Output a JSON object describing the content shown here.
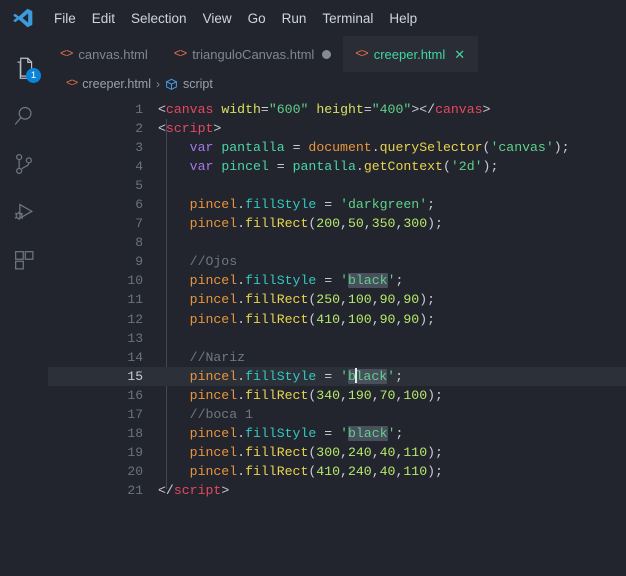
{
  "window": {
    "app_logo": "vscode-logo",
    "background": "#22252d"
  },
  "menubar": {
    "items": [
      {
        "label": "File"
      },
      {
        "label": "Edit"
      },
      {
        "label": "Selection"
      },
      {
        "label": "View"
      },
      {
        "label": "Go"
      },
      {
        "label": "Run"
      },
      {
        "label": "Terminal"
      },
      {
        "label": "Help"
      }
    ]
  },
  "activitybar": {
    "items": [
      {
        "name": "explorer",
        "icon": "files-icon",
        "active": true,
        "badge": "1"
      },
      {
        "name": "search",
        "icon": "search-icon",
        "active": false,
        "badge": ""
      },
      {
        "name": "source-control",
        "icon": "source-control-icon",
        "active": false,
        "badge": ""
      },
      {
        "name": "run-and-debug",
        "icon": "run-and-debug-icon",
        "active": false,
        "badge": ""
      },
      {
        "name": "extensions",
        "icon": "extensions-icon",
        "active": false,
        "badge": ""
      }
    ]
  },
  "tabs": [
    {
      "label": "canvas.html",
      "icon": "html-icon",
      "active": false,
      "dirty": false,
      "close": ""
    },
    {
      "label": "trianguloCanvas.html",
      "icon": "html-icon",
      "active": false,
      "dirty": true,
      "close": ""
    },
    {
      "label": "creeper.html",
      "icon": "html-icon",
      "active": true,
      "dirty": false,
      "close": "✕"
    }
  ],
  "breadcrumbs": {
    "file_icon": "html-icon",
    "file": "creeper.html",
    "separator": "›",
    "symbol_icon": "symbol-namespace-icon",
    "symbol": "script"
  },
  "editor": {
    "language": "html",
    "active_line": 15,
    "cursor": {
      "line": 15,
      "column": 26
    },
    "highlight_word": "black",
    "colors": {
      "background": "#22252d",
      "current_line": "#2c3039",
      "line_number": "#6b7280",
      "line_number_active": "#c8ccd4",
      "tag": "#e8475f",
      "attribute": "#d7e05f",
      "string": "#5fd18a",
      "keyword": "#a678e8",
      "variable": "#4ad6a8",
      "object": "#e8953d",
      "function": "#e8d44d",
      "property": "#35c8c0",
      "number": "#b6e86b",
      "comment": "#707782",
      "accent_green": "#3fd6a0",
      "badge_blue": "#0a84d8",
      "html_icon": "#e8714b"
    },
    "lines": [
      {
        "n": "1",
        "tokens": [
          {
            "t": "punc",
            "v": "<"
          },
          {
            "t": "tag",
            "v": "canvas"
          },
          {
            "t": "plain",
            "v": " "
          },
          {
            "t": "attr",
            "v": "width"
          },
          {
            "t": "punc",
            "v": "="
          },
          {
            "t": "str",
            "v": "\"600\""
          },
          {
            "t": "plain",
            "v": " "
          },
          {
            "t": "attr",
            "v": "height"
          },
          {
            "t": "punc",
            "v": "="
          },
          {
            "t": "str",
            "v": "\"400\""
          },
          {
            "t": "punc",
            "v": "></"
          },
          {
            "t": "tag",
            "v": "canvas"
          },
          {
            "t": "punc",
            "v": ">"
          }
        ]
      },
      {
        "n": "2",
        "tokens": [
          {
            "t": "punc",
            "v": "<"
          },
          {
            "t": "tag",
            "v": "script"
          },
          {
            "t": "punc",
            "v": ">"
          }
        ]
      },
      {
        "n": "3",
        "tokens": [
          {
            "t": "plain",
            "v": "    "
          },
          {
            "t": "kw",
            "v": "var"
          },
          {
            "t": "plain",
            "v": " "
          },
          {
            "t": "var",
            "v": "pantalla"
          },
          {
            "t": "plain",
            "v": " "
          },
          {
            "t": "op",
            "v": "="
          },
          {
            "t": "plain",
            "v": " "
          },
          {
            "t": "obj",
            "v": "document"
          },
          {
            "t": "punc",
            "v": "."
          },
          {
            "t": "fn",
            "v": "querySelector"
          },
          {
            "t": "punc",
            "v": "("
          },
          {
            "t": "str",
            "v": "'canvas'"
          },
          {
            "t": "punc",
            "v": ");"
          }
        ]
      },
      {
        "n": "4",
        "tokens": [
          {
            "t": "plain",
            "v": "    "
          },
          {
            "t": "kw",
            "v": "var"
          },
          {
            "t": "plain",
            "v": " "
          },
          {
            "t": "var",
            "v": "pincel"
          },
          {
            "t": "plain",
            "v": " "
          },
          {
            "t": "op",
            "v": "="
          },
          {
            "t": "plain",
            "v": " "
          },
          {
            "t": "var",
            "v": "pantalla"
          },
          {
            "t": "punc",
            "v": "."
          },
          {
            "t": "fn",
            "v": "getContext"
          },
          {
            "t": "punc",
            "v": "("
          },
          {
            "t": "str",
            "v": "'2d'"
          },
          {
            "t": "punc",
            "v": ");"
          }
        ]
      },
      {
        "n": "5",
        "tokens": []
      },
      {
        "n": "6",
        "tokens": [
          {
            "t": "plain",
            "v": "    "
          },
          {
            "t": "obj",
            "v": "pincel"
          },
          {
            "t": "punc",
            "v": "."
          },
          {
            "t": "prop",
            "v": "fillStyle"
          },
          {
            "t": "plain",
            "v": " "
          },
          {
            "t": "op",
            "v": "="
          },
          {
            "t": "plain",
            "v": " "
          },
          {
            "t": "str",
            "v": "'darkgreen'"
          },
          {
            "t": "punc",
            "v": ";"
          }
        ]
      },
      {
        "n": "7",
        "tokens": [
          {
            "t": "plain",
            "v": "    "
          },
          {
            "t": "obj",
            "v": "pincel"
          },
          {
            "t": "punc",
            "v": "."
          },
          {
            "t": "fn",
            "v": "fillRect"
          },
          {
            "t": "punc",
            "v": "("
          },
          {
            "t": "num",
            "v": "200"
          },
          {
            "t": "punc",
            "v": ","
          },
          {
            "t": "num",
            "v": "50"
          },
          {
            "t": "punc",
            "v": ","
          },
          {
            "t": "num",
            "v": "350"
          },
          {
            "t": "punc",
            "v": ","
          },
          {
            "t": "num",
            "v": "300"
          },
          {
            "t": "punc",
            "v": ");"
          }
        ]
      },
      {
        "n": "8",
        "tokens": []
      },
      {
        "n": "9",
        "tokens": [
          {
            "t": "plain",
            "v": "    "
          },
          {
            "t": "cmt",
            "v": "//Ojos"
          }
        ]
      },
      {
        "n": "10",
        "tokens": [
          {
            "t": "plain",
            "v": "    "
          },
          {
            "t": "obj",
            "v": "pincel"
          },
          {
            "t": "punc",
            "v": "."
          },
          {
            "t": "prop",
            "v": "fillStyle"
          },
          {
            "t": "plain",
            "v": " "
          },
          {
            "t": "op",
            "v": "="
          },
          {
            "t": "plain",
            "v": " "
          },
          {
            "t": "str",
            "v": "'"
          },
          {
            "t": "str-hl",
            "v": "black"
          },
          {
            "t": "str",
            "v": "'"
          },
          {
            "t": "punc",
            "v": ";"
          }
        ]
      },
      {
        "n": "11",
        "tokens": [
          {
            "t": "plain",
            "v": "    "
          },
          {
            "t": "obj",
            "v": "pincel"
          },
          {
            "t": "punc",
            "v": "."
          },
          {
            "t": "fn",
            "v": "fillRect"
          },
          {
            "t": "punc",
            "v": "("
          },
          {
            "t": "num",
            "v": "250"
          },
          {
            "t": "punc",
            "v": ","
          },
          {
            "t": "num",
            "v": "100"
          },
          {
            "t": "punc",
            "v": ","
          },
          {
            "t": "num",
            "v": "90"
          },
          {
            "t": "punc",
            "v": ","
          },
          {
            "t": "num",
            "v": "90"
          },
          {
            "t": "punc",
            "v": ");"
          }
        ]
      },
      {
        "n": "12",
        "tokens": [
          {
            "t": "plain",
            "v": "    "
          },
          {
            "t": "obj",
            "v": "pincel"
          },
          {
            "t": "punc",
            "v": "."
          },
          {
            "t": "fn",
            "v": "fillRect"
          },
          {
            "t": "punc",
            "v": "("
          },
          {
            "t": "num",
            "v": "410"
          },
          {
            "t": "punc",
            "v": ","
          },
          {
            "t": "num",
            "v": "100"
          },
          {
            "t": "punc",
            "v": ","
          },
          {
            "t": "num",
            "v": "90"
          },
          {
            "t": "punc",
            "v": ","
          },
          {
            "t": "num",
            "v": "90"
          },
          {
            "t": "punc",
            "v": ");"
          }
        ]
      },
      {
        "n": "13",
        "tokens": []
      },
      {
        "n": "14",
        "tokens": [
          {
            "t": "plain",
            "v": "    "
          },
          {
            "t": "cmt",
            "v": "//Nariz"
          }
        ]
      },
      {
        "n": "15",
        "tokens": [
          {
            "t": "plain",
            "v": "    "
          },
          {
            "t": "obj",
            "v": "pincel"
          },
          {
            "t": "punc",
            "v": "."
          },
          {
            "t": "prop",
            "v": "fillStyle"
          },
          {
            "t": "plain",
            "v": " "
          },
          {
            "t": "op",
            "v": "="
          },
          {
            "t": "plain",
            "v": " "
          },
          {
            "t": "str",
            "v": "'"
          },
          {
            "t": "str-hl-cursor",
            "v": "black"
          },
          {
            "t": "str",
            "v": "'"
          },
          {
            "t": "punc",
            "v": ";"
          }
        ]
      },
      {
        "n": "16",
        "tokens": [
          {
            "t": "plain",
            "v": "    "
          },
          {
            "t": "obj",
            "v": "pincel"
          },
          {
            "t": "punc",
            "v": "."
          },
          {
            "t": "fn",
            "v": "fillRect"
          },
          {
            "t": "punc",
            "v": "("
          },
          {
            "t": "num",
            "v": "340"
          },
          {
            "t": "punc",
            "v": ","
          },
          {
            "t": "num",
            "v": "190"
          },
          {
            "t": "punc",
            "v": ","
          },
          {
            "t": "num",
            "v": "70"
          },
          {
            "t": "punc",
            "v": ","
          },
          {
            "t": "num",
            "v": "100"
          },
          {
            "t": "punc",
            "v": ");"
          }
        ]
      },
      {
        "n": "17",
        "tokens": [
          {
            "t": "plain",
            "v": "    "
          },
          {
            "t": "cmt",
            "v": "//boca 1"
          }
        ]
      },
      {
        "n": "18",
        "tokens": [
          {
            "t": "plain",
            "v": "    "
          },
          {
            "t": "obj",
            "v": "pincel"
          },
          {
            "t": "punc",
            "v": "."
          },
          {
            "t": "prop",
            "v": "fillStyle"
          },
          {
            "t": "plain",
            "v": " "
          },
          {
            "t": "op",
            "v": "="
          },
          {
            "t": "plain",
            "v": " "
          },
          {
            "t": "str",
            "v": "'"
          },
          {
            "t": "str-hl",
            "v": "black"
          },
          {
            "t": "str",
            "v": "'"
          },
          {
            "t": "punc",
            "v": ";"
          }
        ]
      },
      {
        "n": "19",
        "tokens": [
          {
            "t": "plain",
            "v": "    "
          },
          {
            "t": "obj",
            "v": "pincel"
          },
          {
            "t": "punc",
            "v": "."
          },
          {
            "t": "fn",
            "v": "fillRect"
          },
          {
            "t": "punc",
            "v": "("
          },
          {
            "t": "num",
            "v": "300"
          },
          {
            "t": "punc",
            "v": ","
          },
          {
            "t": "num",
            "v": "240"
          },
          {
            "t": "punc",
            "v": ","
          },
          {
            "t": "num",
            "v": "40"
          },
          {
            "t": "punc",
            "v": ","
          },
          {
            "t": "num",
            "v": "110"
          },
          {
            "t": "punc",
            "v": ");"
          }
        ]
      },
      {
        "n": "20",
        "tokens": [
          {
            "t": "plain",
            "v": "    "
          },
          {
            "t": "obj",
            "v": "pincel"
          },
          {
            "t": "punc",
            "v": "."
          },
          {
            "t": "fn",
            "v": "fillRect"
          },
          {
            "t": "punc",
            "v": "("
          },
          {
            "t": "num",
            "v": "410"
          },
          {
            "t": "punc",
            "v": ","
          },
          {
            "t": "num",
            "v": "240"
          },
          {
            "t": "punc",
            "v": ","
          },
          {
            "t": "num",
            "v": "40"
          },
          {
            "t": "punc",
            "v": ","
          },
          {
            "t": "num",
            "v": "110"
          },
          {
            "t": "punc",
            "v": ");"
          }
        ]
      },
      {
        "n": "21",
        "tokens": [
          {
            "t": "punc",
            "v": "</"
          },
          {
            "t": "tag",
            "v": "script"
          },
          {
            "t": "punc",
            "v": ">"
          }
        ]
      }
    ]
  }
}
